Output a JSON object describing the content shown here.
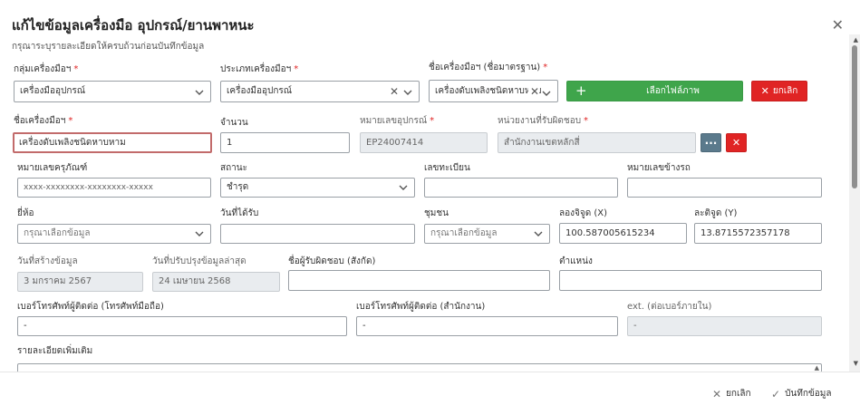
{
  "modal": {
    "title": "แก้ไขข้อมูลเครื่องมือ อุปกรณ์/ยานพาหนะ",
    "subtitle": "กรุณาระบุรายละเอียดให้ครบถ้วนก่อนบันทึกข้อมูล",
    "close_icon": "close-icon"
  },
  "form": {
    "tool_group": {
      "label": "กลุ่มเครื่องมือฯ",
      "value": "เครื่องมืออุปกรณ์"
    },
    "tool_type": {
      "label": "ประเภทเครื่องมือฯ",
      "value": "เครื่องมืออุปกรณ์"
    },
    "tool_std_name": {
      "label": "ชื่อเครื่องมือฯ (ชื่อมาตรฐาน)",
      "value": "เครื่องดับเพลิงชนิดหาบหาม"
    },
    "select_image_label": "เลือกไฟล์ภาพ",
    "cancel_label": "ยกเลิก",
    "tool_name": {
      "label": "ชื่อเครื่องมือฯ",
      "value": "เครื่องดับเพลิงชนิดหาบหาม"
    },
    "quantity": {
      "label": "จำนวน",
      "value": "1"
    },
    "device_no": {
      "label": "หมายเลขอุปกรณ์",
      "value": "EP24007414"
    },
    "resp_unit": {
      "label": "หน่วยงานที่รับผิดชอบ",
      "value": "สำนักงานเขตหลักสี่"
    },
    "asset_no": {
      "label": "หมายเลขครุภัณฑ์",
      "value": "xxxx-xxxxxxxx-xxxxxxxx-xxxxx"
    },
    "status": {
      "label": "สถานะ",
      "value": "ชำรุด"
    },
    "reg_no": {
      "label": "เลขทะเบียน",
      "value": ""
    },
    "side_no": {
      "label": "หมายเลขข้างรถ",
      "value": ""
    },
    "brand": {
      "label": "ยี่ห้อ",
      "value": "กรุณาเลือกข้อมูล"
    },
    "received_date": {
      "label": "วันที่ได้รับ",
      "value": ""
    },
    "community": {
      "label": "ชุมชน",
      "value": "กรุณาเลือกข้อมูล"
    },
    "longitude": {
      "label": "ลองจิจูด (X)",
      "value": "100.587005615234"
    },
    "latitude": {
      "label": "ละติจูด (Y)",
      "value": "13.8715572357178"
    },
    "created_date": {
      "label": "วันที่สร้างข้อมูล",
      "value": "3 มกราคม 2567"
    },
    "updated_date": {
      "label": "วันที่ปรับปรุงข้อมูลล่าสุด",
      "value": "24 เมษายน 2568"
    },
    "resp_person": {
      "label": "ชื่อผู้รับผิดชอบ (สังกัด)",
      "value": ""
    },
    "position": {
      "label": "ตำแหน่ง",
      "value": ""
    },
    "mobile": {
      "label": "เบอร์โทรศัพท์ผู้ติดต่อ (โทรศัพท์มือถือ)",
      "value": "-"
    },
    "office_phone": {
      "label": "เบอร์โทรศัพท์ผู้ติดต่อ (สำนักงาน)",
      "value": "-"
    },
    "ext": {
      "label": "ext. (ต่อเบอร์ภายใน)",
      "value": "-"
    },
    "details": {
      "label": "รายละเอียดเพิ่มเติม"
    }
  },
  "footer": {
    "cancel_label": "ยกเลิก",
    "save_label": "บันทึกข้อมูล"
  }
}
